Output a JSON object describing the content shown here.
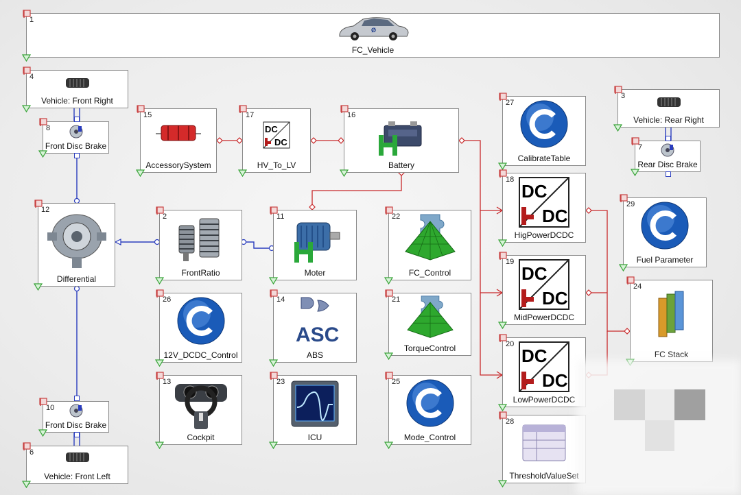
{
  "blocks": {
    "fc_vehicle": {
      "num": "1",
      "label": "FC_Vehicle",
      "icon": "car-icon"
    },
    "front_right": {
      "num": "4",
      "label": "Vehicle: Front Right",
      "icon": "tire-icon"
    },
    "front_disc_brake_8": {
      "num": "8",
      "label": "Front Disc Brake",
      "icon": "disc-brake-icon"
    },
    "differential": {
      "num": "12",
      "label": "Differential",
      "icon": "differential-gear-icon"
    },
    "front_disc_brake_10": {
      "num": "10",
      "label": "Front Disc Brake",
      "icon": "disc-brake-icon"
    },
    "front_left": {
      "num": "6",
      "label": "Vehicle: Front Left",
      "icon": "tire-icon"
    },
    "accessory": {
      "num": "15",
      "label": "AccessorySystem",
      "icon": "resistor-icon"
    },
    "hv_to_lv": {
      "num": "17",
      "label": "HV_To_LV",
      "icon": "dcdc-icon"
    },
    "battery": {
      "num": "16",
      "label": "Battery",
      "icon": "battery-icon"
    },
    "front_ratio": {
      "num": "2",
      "label": "FrontRatio",
      "icon": "gear-ratio-icon"
    },
    "moter": {
      "num": "11",
      "label": "Moter",
      "icon": "motor-icon"
    },
    "fc_control": {
      "num": "22",
      "label": "FC_Control",
      "icon": "surface-puzzle-icon"
    },
    "calibrate": {
      "num": "27",
      "label": "CalibrateTable",
      "icon": "c-script-icon"
    },
    "hig_dcdc": {
      "num": "18",
      "label": "HigPowerDCDC",
      "icon": "dcdc-icon"
    },
    "mid_dcdc": {
      "num": "19",
      "label": "MidPowerDCDC",
      "icon": "dcdc-icon"
    },
    "low_dcdc": {
      "num": "20",
      "label": "LowPowerDCDC",
      "icon": "dcdc-icon"
    },
    "rear_right": {
      "num": "3",
      "label": "Vehicle: Rear Right",
      "icon": "tire-icon"
    },
    "rear_disc_brake": {
      "num": "7",
      "label": "Rear Disc Brake",
      "icon": "disc-brake-icon"
    },
    "fuel_param": {
      "num": "29",
      "label": "Fuel Parameter",
      "icon": "c-script-icon"
    },
    "fc_stack": {
      "num": "24",
      "label": "FC Stack",
      "icon": "fuel-cell-stack-icon"
    },
    "dcdc_12v": {
      "num": "26",
      "label": "12V_DCDC_Control",
      "icon": "c-script-icon"
    },
    "abs": {
      "num": "14",
      "label": "ABS",
      "icon": "asc-logic-icon",
      "icon_text": "ASC"
    },
    "torque_control": {
      "num": "21",
      "label": "TorqueControl",
      "icon": "surface-puzzle-icon"
    },
    "cockpit": {
      "num": "13",
      "label": "Cockpit",
      "icon": "steering-wheel-icon"
    },
    "icu": {
      "num": "23",
      "label": "ICU",
      "icon": "oscilloscope-icon"
    },
    "mode_control": {
      "num": "25",
      "label": "Mode_Control",
      "icon": "c-script-icon"
    },
    "threshold": {
      "num": "28",
      "label": "ThresholdValueSet",
      "icon": "table-window-icon"
    }
  },
  "icon_text": {
    "dc": "DC"
  },
  "colors": {
    "electric_wire": "#c8282a",
    "mechanical_wire": "#2a3dbe",
    "c_icon": "#1a5bb8",
    "surface_green": "#2ea82e"
  }
}
